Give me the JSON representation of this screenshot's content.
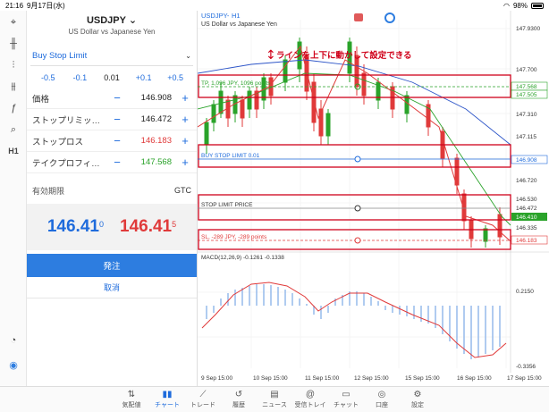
{
  "status": {
    "time": "21:16",
    "date": "9月17日(水)",
    "battery": "98%"
  },
  "sidebar": {
    "icons": [
      "crosshair-icon",
      "indicators-icon",
      "bar-chart-icon",
      "settings-sliders-icon",
      "function-icon",
      "objects-icon",
      "timeframe-h1-label",
      "clock-icon",
      "app-logo-icon"
    ],
    "timeframe": "H1"
  },
  "order": {
    "symbol": "USDJPY",
    "symbol_sub": "US Dollar vs Japanese Yen",
    "order_type": "Buy Stop Limit",
    "volume_steps": [
      "-0.5",
      "-0.1",
      "0.01",
      "+0.1",
      "+0.5"
    ],
    "fields": [
      {
        "label": "価格",
        "value": "146.908",
        "color": "#222222"
      },
      {
        "label": "ストップリミッ…",
        "value": "146.472",
        "color": "#222222"
      },
      {
        "label": "ストップロス",
        "value": "146.183",
        "color": "#e03a3a"
      },
      {
        "label": "テイクプロフィ…",
        "value": "147.568",
        "color": "#2aa32a"
      }
    ],
    "expiry_label": "有効期限",
    "expiry_value": "GTC",
    "bid_main": "146.41",
    "bid_sup": "0",
    "ask_main": "146.41",
    "ask_sup": "5",
    "submit_label": "発注",
    "cancel_label": "取消"
  },
  "chart": {
    "title": "USDJPY-",
    "timeframe": "H1",
    "subtitle": "US Dollar vs Japanese Yen",
    "annotation": "ラインを上下に動かして設定できる",
    "lines": {
      "tp": "TP, 1,096 JPY, 1096 points",
      "buy": "BUY STOP LIMIT 0.01",
      "limit": "STOP LIMIT PRICE",
      "sl": "SL, -289 JPY, -289 points"
    },
    "price_axis": [
      "147.9300",
      "147.700",
      "147.568",
      "147.505",
      "147.310",
      "147.115",
      "146.908",
      "146.720",
      "146.530",
      "146.472",
      "146.410",
      "146.335",
      "146.183"
    ],
    "macd_label": "MACD(12,26,9) -0.1261 -0.1338",
    "macd_axis": [
      "0.2150",
      "-0.3356"
    ],
    "time_labels": [
      "9 Sep 15:00",
      "10 Sep 15:00",
      "11 Sep 15:00",
      "12 Sep 15:00",
      "15 Sep 15:00",
      "16 Sep 15:00",
      "17 Sep 15:00"
    ],
    "colors": {
      "tp": "#2aa32a",
      "sl": "#e03a3a",
      "highlight": "#d0021b",
      "buy": "#1e6bdc"
    }
  },
  "tabs": [
    {
      "label": "気配値",
      "icon": "quotes-icon"
    },
    {
      "label": "チャート",
      "icon": "chart-icon"
    },
    {
      "label": "トレード",
      "icon": "trade-icon"
    },
    {
      "label": "履歴",
      "icon": "history-icon"
    },
    {
      "label": "ニュース",
      "icon": "news-icon"
    },
    {
      "label": "受信トレイ",
      "icon": "mail-icon"
    },
    {
      "label": "チャット",
      "icon": "chat-icon"
    },
    {
      "label": "口座",
      "icon": "account-icon"
    },
    {
      "label": "設定",
      "icon": "settings-icon"
    }
  ]
}
